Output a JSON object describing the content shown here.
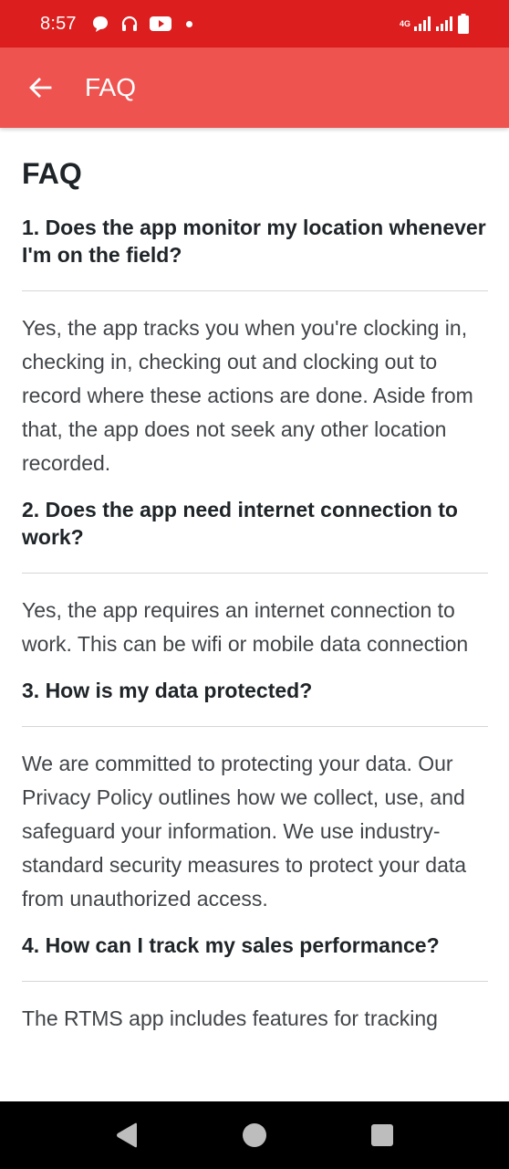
{
  "status_bar": {
    "time": "8:57",
    "network": "4G",
    "icons": [
      "chat-bubble-icon",
      "headphones-icon",
      "youtube-icon",
      "dot-icon",
      "signal-icon",
      "signal-icon",
      "battery-icon"
    ]
  },
  "app_bar": {
    "title": "FAQ",
    "back_icon": "arrow-left-icon",
    "color": "#ef5350"
  },
  "page": {
    "heading": "FAQ",
    "faqs": [
      {
        "question": "1. Does the app monitor my location whenever I'm on the field?",
        "answer": "Yes, the app tracks you when you're clocking in, checking in, checking out and clocking out to record where these actions are done. Aside from that, the app does not seek any other location recorded."
      },
      {
        "question": "2. Does the app need internet connection to work?",
        "answer": "Yes, the app requires an internet connection to work. This can be wifi or mobile data connection"
      },
      {
        "question": "3. How is my data protected?",
        "answer": "We are committed to protecting your data. Our Privacy Policy outlines how we collect, use, and safeguard your information. We use industry-standard security measures to protect your data from unauthorized access."
      },
      {
        "question": "4. How can I track my sales performance?",
        "answer": "The RTMS app includes features for tracking"
      }
    ]
  },
  "nav_bar": {
    "back": "triangle-back-icon",
    "home": "circle-home-icon",
    "recents": "square-recents-icon"
  },
  "colors": {
    "status_bar": "#dc1e1e",
    "app_bar": "#ef5350",
    "text": "#1f2428",
    "divider": "#d6d6d6"
  }
}
